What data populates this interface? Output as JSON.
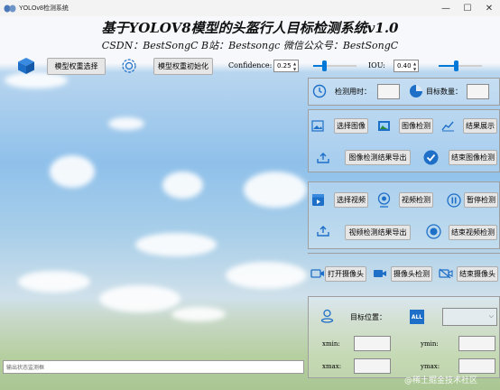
{
  "window": {
    "title": "YOLOv8检测系统",
    "min": "—",
    "max": "☐",
    "close": "✕"
  },
  "header": {
    "title": "基于YOLOV8模型的头盔行人目标检测系统v1.0",
    "subtitle": "CSDN：BestSongC   B站：Bestsongc   微信公众号：BestSongC"
  },
  "toolbar": {
    "select_weights": "模型权重选择",
    "init_weights": "模型权重初始化",
    "confidence_label": "Confidence:",
    "confidence_value": "0.25",
    "confidence_slider": 0.25,
    "iou_label": "IOU:",
    "iou_value": "0.40",
    "iou_slider": 0.4
  },
  "stats": {
    "time_label": "检测用时：",
    "time_value": "",
    "count_label": "目标数量：",
    "count_value": ""
  },
  "image": {
    "select": "选择图像",
    "detect": "图像检测",
    "show": "结果展示",
    "export": "图像检测结果导出",
    "end": "结束图像检测"
  },
  "video": {
    "select": "选择视频",
    "detect": "视频检测",
    "pause": "暂停检测",
    "export": "视频检测结果导出",
    "end": "结束视频检测"
  },
  "camera": {
    "open": "打开摄像头",
    "detect": "摄像头检测",
    "end": "结束摄像头"
  },
  "target": {
    "position_label": "目标位置：",
    "all_icon_text": "ALL",
    "select_value": "",
    "xmin_label": "xmin:",
    "xmin_value": "",
    "ymin_label": "ymin:",
    "ymin_value": "",
    "xmax_label": "xmax:",
    "xmax_value": "",
    "ymax_label": "ymax:",
    "ymax_value": ""
  },
  "status": {
    "placeholder": "输出状态监测框"
  },
  "watermark": "@稀土掘金技术社区",
  "colors": {
    "accent": "#0078d7",
    "icon_blue": "#1e6fc8"
  }
}
